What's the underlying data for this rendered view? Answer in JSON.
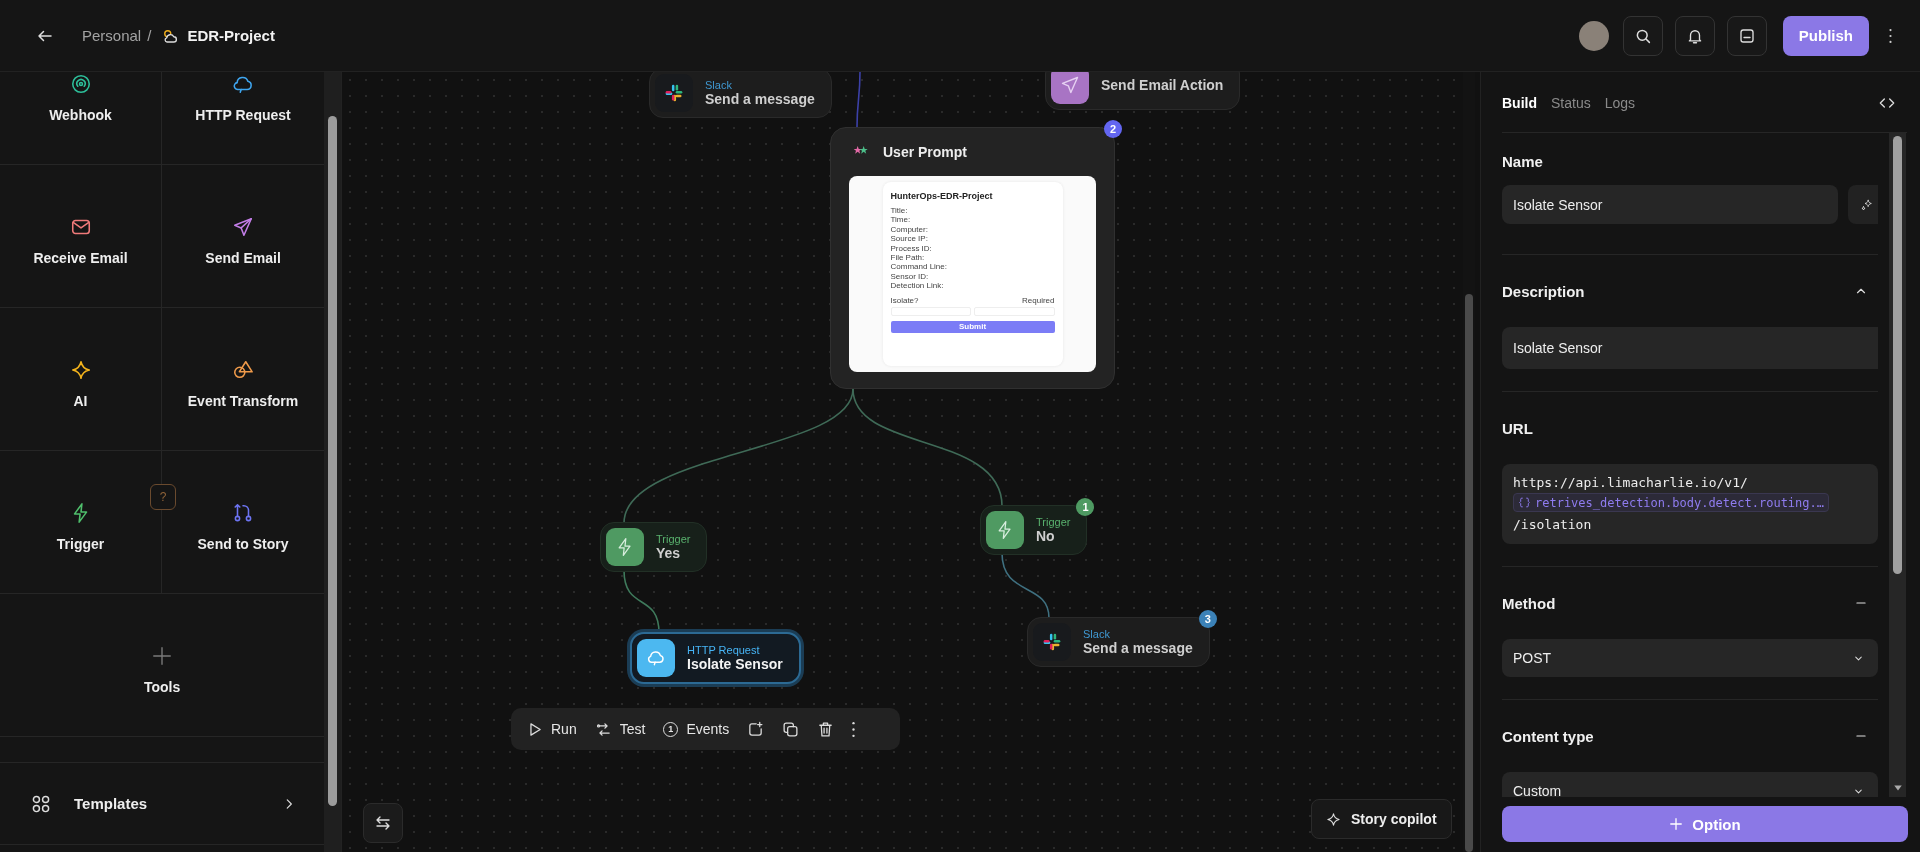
{
  "header": {
    "parent": "Personal",
    "separator": "/",
    "title": "EDR-Project",
    "publish": "Publish"
  },
  "sidebar": {
    "tools": [
      {
        "kind": "webhook",
        "label": "Webhook"
      },
      {
        "kind": "http",
        "label": "HTTP Request"
      },
      {
        "kind": "receive-email",
        "label": "Receive Email"
      },
      {
        "kind": "send-email",
        "label": "Send Email"
      },
      {
        "kind": "ai",
        "label": "AI"
      },
      {
        "kind": "transform",
        "label": "Event Transform"
      },
      {
        "kind": "trigger",
        "label": "Trigger"
      },
      {
        "kind": "send-to-story",
        "label": "Send to Story"
      },
      {
        "kind": "tools",
        "label": "Tools"
      }
    ],
    "help": "?",
    "templates": "Templates"
  },
  "canvas": {
    "nodes": [
      {
        "kind": "slack",
        "type_label": "Slack",
        "title": "Send a message",
        "selected": false
      },
      {
        "kind": "email",
        "title": "Send Email Action",
        "selected": false
      },
      {
        "kind": "trigger",
        "type_label": "Trigger",
        "title": "Yes",
        "selected": false
      },
      {
        "kind": "trigger",
        "type_label": "Trigger",
        "title": "No",
        "selected": false,
        "badge": {
          "text": "1",
          "color": "#4e9a62"
        }
      },
      {
        "kind": "http",
        "type_label": "HTTP Request",
        "title": "Isolate Sensor",
        "selected": true
      },
      {
        "kind": "slack",
        "type_label": "Slack",
        "title": "Send a message",
        "selected": false,
        "badge": {
          "text": "3",
          "color": "#3b82b8"
        }
      }
    ],
    "prompt": {
      "title": "User Prompt",
      "badge": {
        "text": "2",
        "color": "#6366f1"
      },
      "preview": {
        "heading": "HunterOps-EDR-Project",
        "fields": [
          "Title:",
          "Time:",
          "Computer:",
          "Source IP:",
          "Process ID:",
          "File Path:",
          "Command Line:",
          "Sensor ID:",
          "Detection Link:"
        ],
        "question": "Isolate?",
        "required": "Required",
        "submit": "Submit"
      }
    },
    "toolbar": [
      {
        "kind": "run",
        "label": "Run"
      },
      {
        "kind": "test",
        "label": "Test"
      },
      {
        "kind": "events",
        "label": "Events",
        "count": "1"
      },
      {
        "kind": "add"
      },
      {
        "kind": "duplicate"
      },
      {
        "kind": "delete"
      },
      {
        "kind": "more"
      }
    ],
    "copilot": "Story copilot"
  },
  "panel": {
    "tabs": [
      {
        "label": "Build",
        "selected": true
      },
      {
        "label": "Status",
        "selected": false
      },
      {
        "label": "Logs",
        "selected": false
      }
    ],
    "sections": [
      {
        "kind": "name",
        "label": "Name",
        "value": "Isolate Sensor"
      },
      {
        "kind": "textarea",
        "label": "Description",
        "expanded": true,
        "value": "Isolate Sensor"
      },
      {
        "kind": "url",
        "label": "URL",
        "parts": [
          {
            "kind": "text",
            "text": "https://api.limacharlie.io/v1/"
          },
          {
            "kind": "variable",
            "text": "retrives_detection.body.detect.routing.…"
          },
          {
            "kind": "text",
            "text": "/isolation"
          }
        ]
      },
      {
        "kind": "select",
        "label": "Method",
        "expanded": true,
        "value": "POST"
      },
      {
        "kind": "select",
        "label": "Content type",
        "expanded": true,
        "value": "Custom"
      }
    ],
    "option_button": "Option"
  }
}
